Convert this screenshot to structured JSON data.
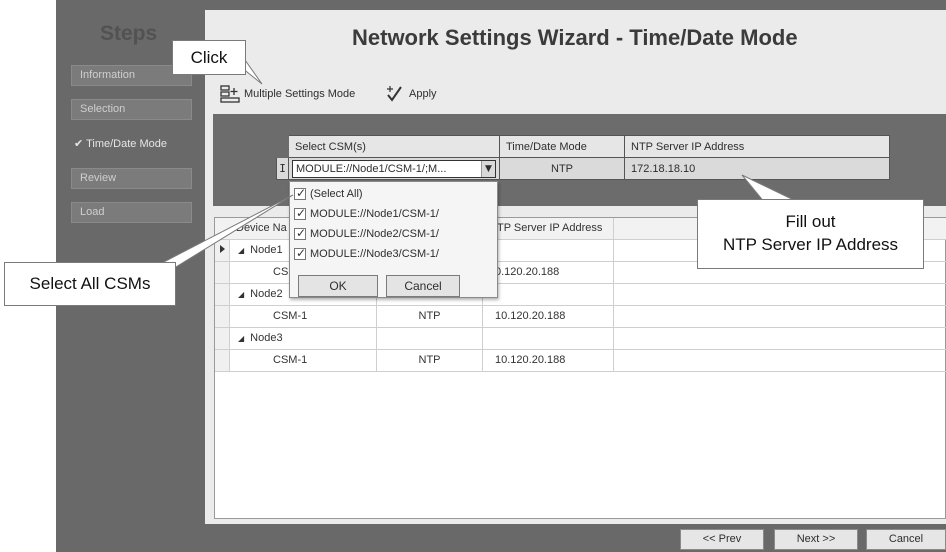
{
  "steps": {
    "title": "Steps",
    "items": [
      {
        "label": "Information",
        "active": false
      },
      {
        "label": "Selection",
        "active": false
      },
      {
        "label": "✔ Time/Date Mode",
        "active": true
      },
      {
        "label": "Review",
        "active": false
      },
      {
        "label": "Load",
        "active": false
      }
    ]
  },
  "wizard": {
    "title": "Network Settings Wizard - Time/Date Mode"
  },
  "toolbar": {
    "multiple_settings": "Multiple Settings Mode",
    "apply": "Apply"
  },
  "settings_table": {
    "headers": [
      "Select CSM(s)",
      "Time/Date Mode",
      "NTP Server IP Address"
    ],
    "row": {
      "marker": "I",
      "csm": "MODULE://Node1/CSM-1/;M...",
      "mode": "NTP",
      "ip": "172.18.18.10"
    }
  },
  "dropdown": {
    "items": [
      "(Select All)",
      "MODULE://Node1/CSM-1/",
      "MODULE://Node2/CSM-1/",
      "MODULE://Node3/CSM-1/"
    ],
    "ok": "OK",
    "cancel": "Cancel"
  },
  "grid": {
    "headers": {
      "device_name": "Device Na",
      "ip": "TP Server IP Address"
    },
    "rows": [
      {
        "type": "node",
        "name": "Node1",
        "mode": "",
        "ip": ""
      },
      {
        "type": "csm",
        "name": "CS",
        "mode": "",
        "ip": "0.120.20.188"
      },
      {
        "type": "node",
        "name": "Node2",
        "mode": "",
        "ip": ""
      },
      {
        "type": "csm",
        "name": "CSM-1",
        "mode": "NTP",
        "ip": "10.120.20.188"
      },
      {
        "type": "node",
        "name": "Node3",
        "mode": "",
        "ip": ""
      },
      {
        "type": "csm",
        "name": "CSM-1",
        "mode": "NTP",
        "ip": "10.120.20.188"
      }
    ]
  },
  "callouts": {
    "click": "Click",
    "select_all": "Select All CSMs",
    "fill_out_line1": "Fill out",
    "fill_out_line2": "NTP Server IP Address"
  },
  "footer": {
    "prev": "<< Prev",
    "next": "Next >>",
    "cancel": "Cancel"
  }
}
